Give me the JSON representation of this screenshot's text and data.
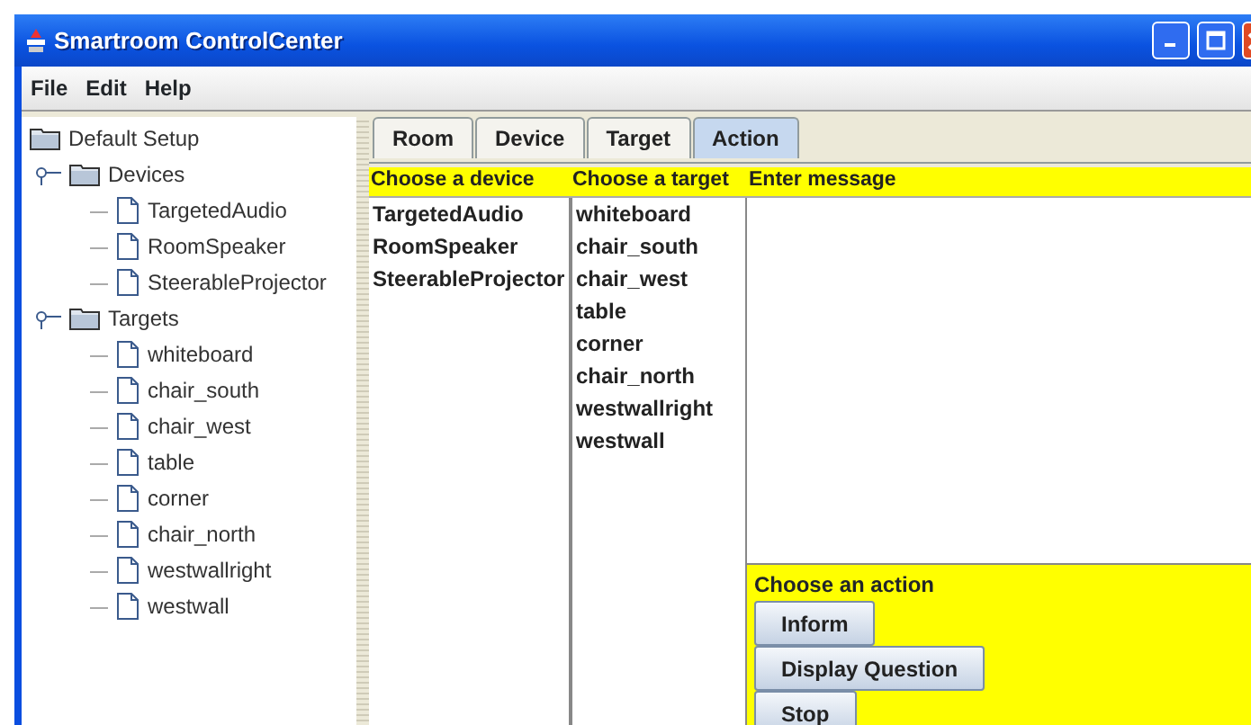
{
  "window": {
    "title": "Smartroom ControlCenter"
  },
  "menu": [
    "File",
    "Edit",
    "Help"
  ],
  "tree": {
    "label": "Default Setup",
    "children": [
      {
        "label": "Devices",
        "expanded": true,
        "children": [
          {
            "label": "TargetedAudio"
          },
          {
            "label": "RoomSpeaker"
          },
          {
            "label": "SteerableProjector"
          }
        ]
      },
      {
        "label": "Targets",
        "expanded": true,
        "children": [
          {
            "label": "whiteboard"
          },
          {
            "label": "chair_south"
          },
          {
            "label": "chair_west"
          },
          {
            "label": "table"
          },
          {
            "label": "corner"
          },
          {
            "label": "chair_north"
          },
          {
            "label": "westwallright"
          },
          {
            "label": "westwall"
          }
        ]
      }
    ]
  },
  "tabs": [
    {
      "label": "Room",
      "selected": false
    },
    {
      "label": "Device",
      "selected": false
    },
    {
      "label": "Target",
      "selected": false
    },
    {
      "label": "Action",
      "selected": true
    }
  ],
  "device_list": {
    "heading": "Choose a device",
    "items": [
      "TargetedAudio",
      "RoomSpeaker",
      "SteerableProjector"
    ]
  },
  "target_list": {
    "heading": "Choose a target",
    "items": [
      "whiteboard",
      "chair_south",
      "chair_west",
      "table",
      "corner",
      "chair_north",
      "westwallright",
      "westwall"
    ]
  },
  "message": {
    "heading": "Enter message"
  },
  "actions": {
    "heading": "Choose an action",
    "buttons": [
      "Inform",
      "Display Question",
      "Stop"
    ]
  }
}
